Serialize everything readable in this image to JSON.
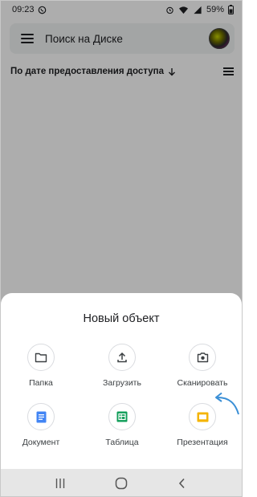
{
  "status_bar": {
    "time": "09:23",
    "battery_percent": "59%"
  },
  "search": {
    "placeholder": "Поиск на Диске"
  },
  "sort": {
    "label": "По дате предоставления доступа"
  },
  "sheet": {
    "title": "Новый объект",
    "actions": [
      {
        "label": "Папка",
        "icon": "folder-icon"
      },
      {
        "label": "Загрузить",
        "icon": "upload-icon"
      },
      {
        "label": "Сканировать",
        "icon": "camera-icon"
      },
      {
        "label": "Документ",
        "icon": "docs-icon"
      },
      {
        "label": "Таблица",
        "icon": "sheets-icon"
      },
      {
        "label": "Презентация",
        "icon": "slides-icon"
      }
    ]
  },
  "colors": {
    "docs_blue": "#4285f4",
    "sheets_green": "#0f9d58",
    "slides_yellow": "#f4b400",
    "annotation_arrow": "#3a8fd6"
  }
}
